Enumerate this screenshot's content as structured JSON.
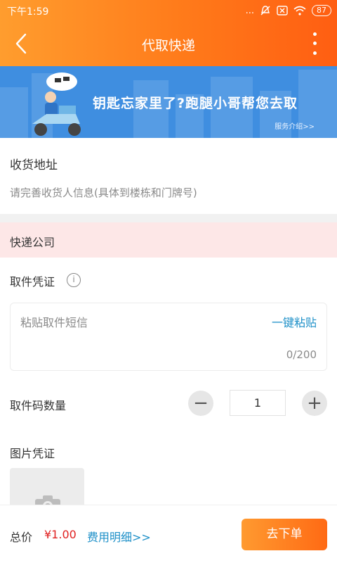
{
  "status_bar": {
    "time": "下午1:59",
    "signal": "...",
    "battery": "87"
  },
  "nav": {
    "title": "代取快递"
  },
  "banner": {
    "headline": "钥匙忘家里了?跑腿小哥帮您去取",
    "link": "服务介绍>>"
  },
  "address": {
    "label": "收货地址",
    "placeholder": "请完善收货人信息(具体到楼栋和门牌号)"
  },
  "courier": {
    "label": "快递公司"
  },
  "voucher": {
    "label": "取件凭证",
    "info_glyph": "i",
    "sms_placeholder": "粘贴取件短信",
    "paste_label": "一键粘贴",
    "counter": "0/200"
  },
  "quantity": {
    "label": "取件码数量",
    "value": "1",
    "minus_glyph": "−",
    "plus_glyph": "+"
  },
  "image_voucher": {
    "label": "图片凭证"
  },
  "footer": {
    "total_label": "总价",
    "total_price": "¥1.00",
    "fee_detail": "费用明细>>",
    "submit": "去下单"
  },
  "colors": {
    "accent": "#ff7a1a",
    "link": "#1e90c8",
    "price": "#e02020",
    "banner": "#3f8ee0"
  }
}
